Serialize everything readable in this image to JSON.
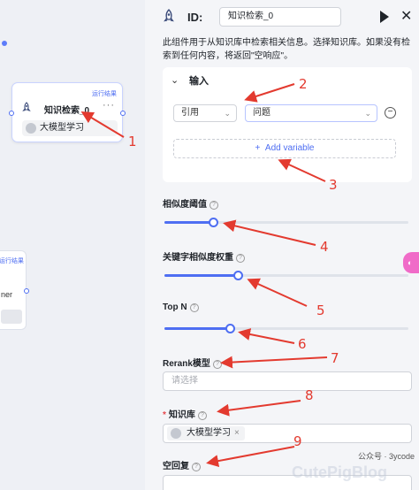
{
  "canvas": {
    "node": {
      "run_label": "运行结果",
      "title": "知识检索_0",
      "more": "···",
      "knowledge_base": "大模型学习"
    },
    "node2": {
      "run_label": "运行结果",
      "partial_text": "ner"
    }
  },
  "panel": {
    "id_label": "ID:",
    "id_value": "知识检索_0",
    "description": "此组件用于从知识库中检索相关信息。选择知识库。如果没有检索到任何内容，将返回\"空响应\"。",
    "input_section": {
      "title": "输入",
      "ref_select": "引用",
      "var_select": "问题",
      "add_variable": "Add variable"
    },
    "similarity_threshold": {
      "label": "相似度阈值",
      "value": 0.2
    },
    "keyword_weight": {
      "label": "关键字相似度权重",
      "value": 0.3
    },
    "top_n": {
      "label": "Top N",
      "value": 8
    },
    "rerank": {
      "label": "Rerank模型",
      "placeholder": "请选择"
    },
    "knowledge": {
      "label": "知识库",
      "required_mark": "*",
      "tag": "大模型学习",
      "tag_close": "×"
    },
    "empty_response": {
      "label": "空回复"
    }
  },
  "side_chip": "◐",
  "watermark": "公众号 · 3ycode",
  "watermark_logo": "CutePigBlog",
  "annotations": [
    "1",
    "2",
    "3",
    "4",
    "5",
    "6",
    "7",
    "8",
    "9"
  ],
  "colors": {
    "accent": "#4e6ef2",
    "annotation": "#e33a2f",
    "required": "#e5484d"
  }
}
